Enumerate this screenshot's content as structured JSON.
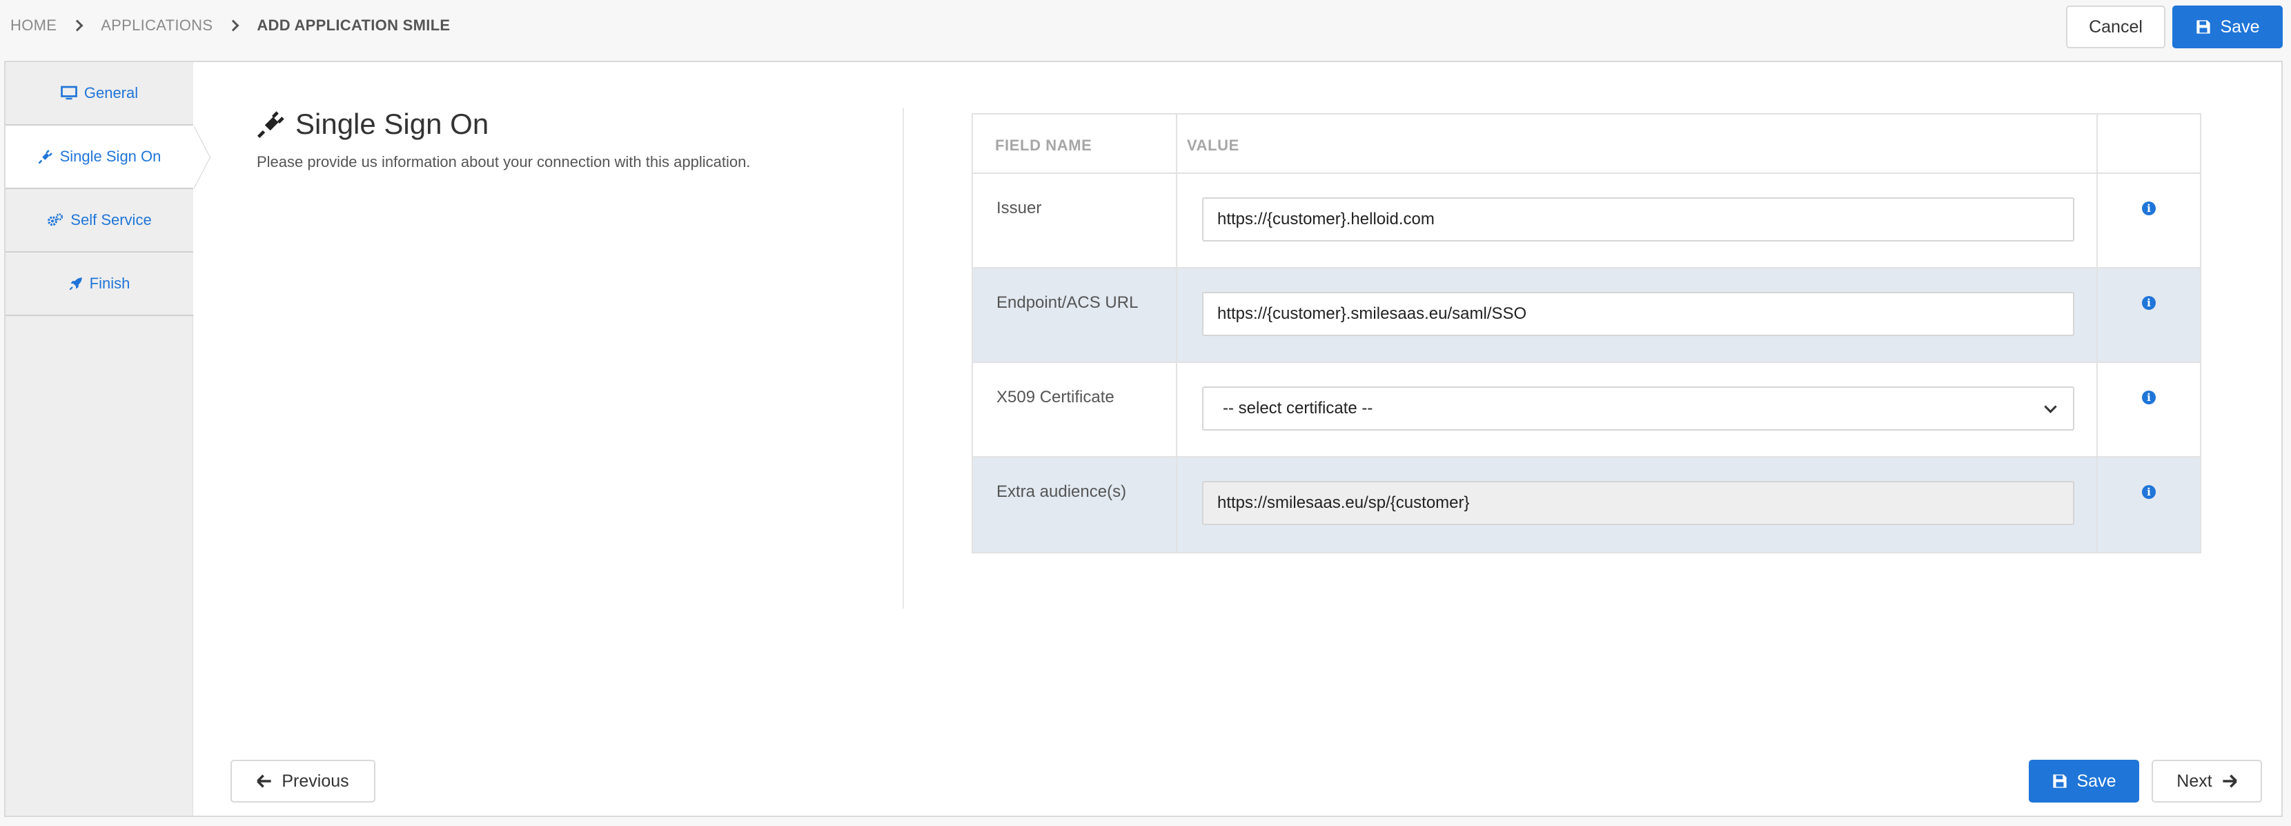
{
  "breadcrumb": {
    "items": [
      "HOME",
      "APPLICATIONS",
      "ADD APPLICATION SMILE"
    ]
  },
  "top_actions": {
    "cancel_label": "Cancel",
    "save_label": "Save"
  },
  "sidebar": {
    "items": [
      {
        "label": "General",
        "icon": "monitor-icon",
        "active": false
      },
      {
        "label": "Single Sign On",
        "icon": "plug-icon",
        "active": true
      },
      {
        "label": "Self Service",
        "icon": "gears-icon",
        "active": false
      },
      {
        "label": "Finish",
        "icon": "rocket-icon",
        "active": false
      }
    ]
  },
  "main": {
    "title": "Single Sign On",
    "title_icon": "plug-icon",
    "description": "Please provide us information about your connection with this application."
  },
  "table": {
    "headers": {
      "field_name": "FIELD NAME",
      "value": "VALUE"
    },
    "rows": [
      {
        "name": "Issuer",
        "type": "input",
        "value": "https://{customer}.helloid.com"
      },
      {
        "name": "Endpoint/ACS URL",
        "type": "input",
        "value": "https://{customer}.smilesaas.eu/saml/SSO"
      },
      {
        "name": "X509 Certificate",
        "type": "select",
        "value": "-- select certificate --"
      },
      {
        "name": "Extra audience(s)",
        "type": "input",
        "value": "https://smilesaas.eu/sp/{customer}"
      }
    ]
  },
  "bottom_actions": {
    "previous_label": "Previous",
    "save_label": "Save",
    "next_label": "Next"
  },
  "colors": {
    "accent": "#1f75d8",
    "shaded_row": "#e2e9f1"
  }
}
